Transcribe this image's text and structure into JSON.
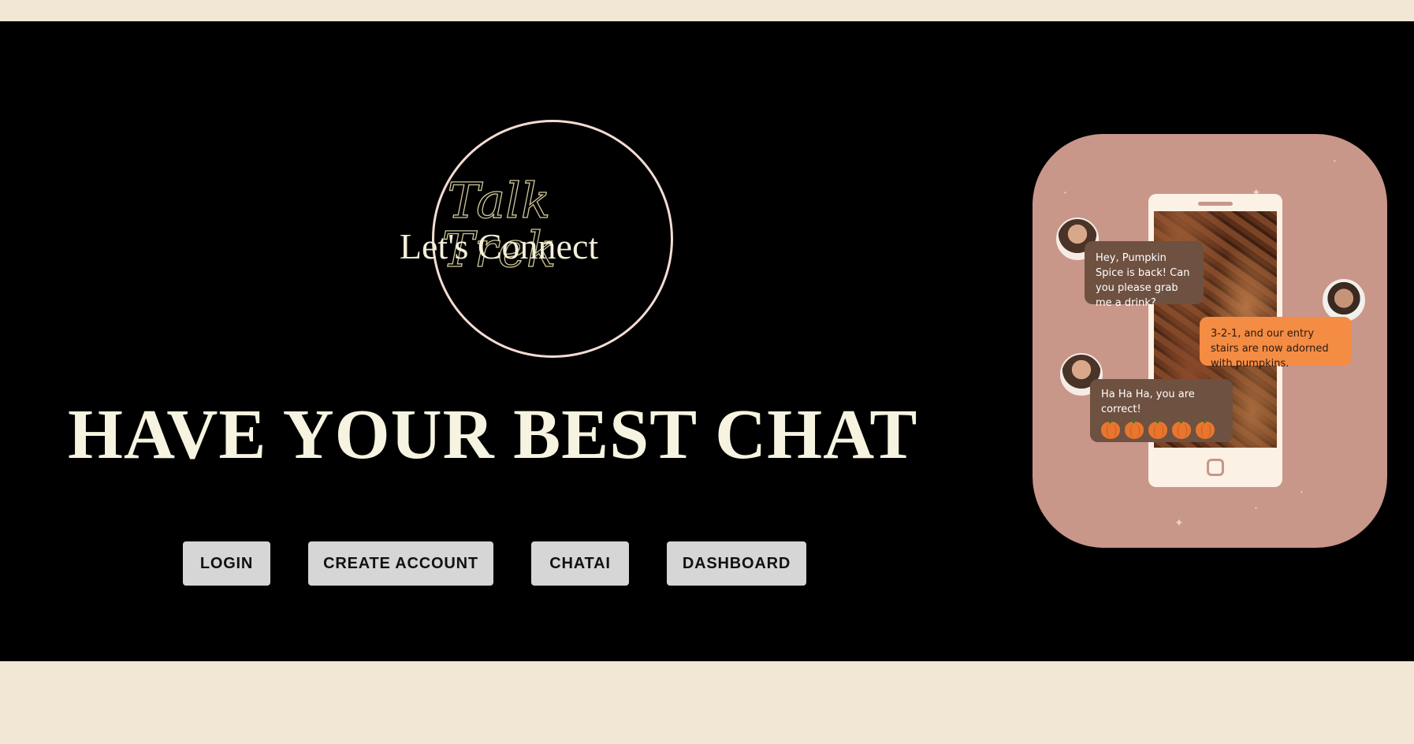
{
  "logo": {
    "title": "Talk Trek",
    "subtitle": "Let's Connect"
  },
  "hero": {
    "headline": "HAVE YOUR BEST CHAT"
  },
  "buttons": {
    "login": "LOGIN",
    "create_account": "CREATE ACCOUNT",
    "chatai": "CHATAI",
    "dashboard": "DASHBOARD"
  },
  "illustration": {
    "messages": [
      {
        "text": "Hey, Pumpkin Spice is back! Can you please grab me a drink?"
      },
      {
        "text": "3-2-1, and our entry stairs are now adorned with pumpkins."
      },
      {
        "text": "Ha Ha Ha, you are correct!"
      }
    ],
    "pumpkin_count": 5
  },
  "colors": {
    "page_background": "#f2e6d4",
    "hero_background": "#000000",
    "button_background": "#d6d6d6",
    "card_background": "#c9968a",
    "accent_orange": "#f48c44",
    "bubble_brown": "#6e5140"
  }
}
